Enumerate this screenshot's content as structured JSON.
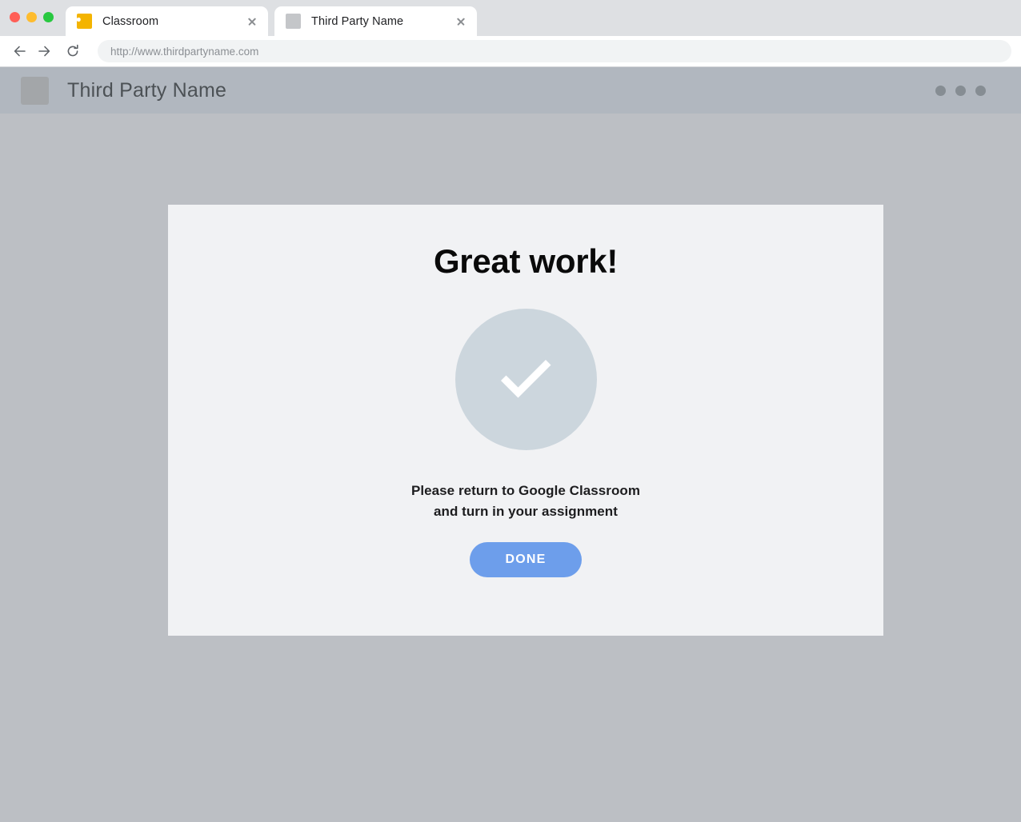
{
  "browser": {
    "traffic_lights": [
      {
        "name": "close",
        "color": "#ff5f57"
      },
      {
        "name": "minimize",
        "color": "#febc2e"
      },
      {
        "name": "maximize",
        "color": "#28c840"
      }
    ],
    "tabs": [
      {
        "title": "Classroom",
        "favicon": "google-classroom-icon",
        "active": false
      },
      {
        "title": "Third Party Name",
        "favicon": "placeholder-square-icon",
        "active": true
      }
    ],
    "toolbar": {
      "back_icon": "arrow-left-icon",
      "forward_icon": "arrow-right-icon",
      "reload_icon": "reload-icon",
      "url_value": "http://www.thirdpartyname.com"
    }
  },
  "site_header": {
    "logo": "placeholder-logo",
    "title": "Third Party Name",
    "menu_dots": 3,
    "background_color": "#b1b7bf"
  },
  "card": {
    "heading": "Great work!",
    "status_icon": "checkmark-circle-icon",
    "status_icon_color": "#ccd6dd",
    "message_line_1": "Please return to Google Classroom",
    "message_line_2": "and turn in your assignment",
    "done_label": "DONE",
    "done_color": "#6d9eeb",
    "background_color": "#f1f2f4"
  },
  "page": {
    "background_color": "#bcbfc4"
  }
}
